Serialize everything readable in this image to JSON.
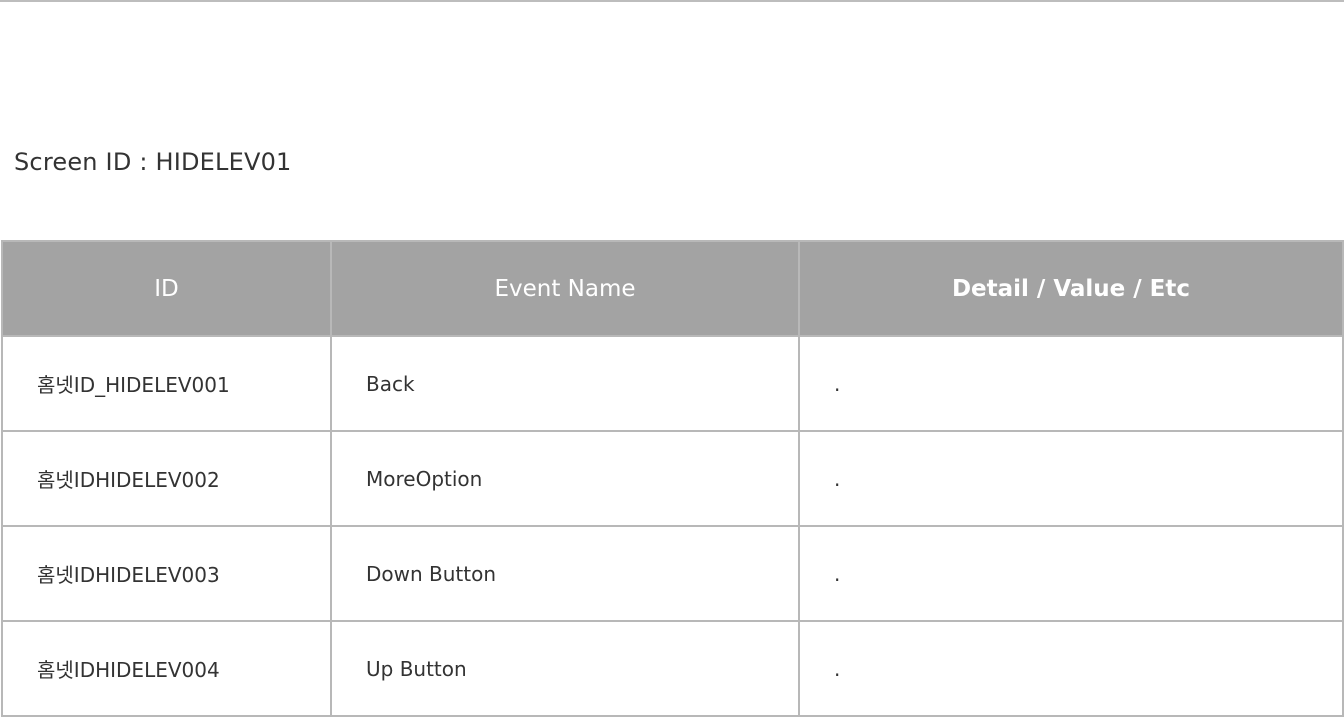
{
  "screen_id": "Screen ID : HIDELEV01",
  "table": {
    "headers": {
      "id": "ID",
      "event_name": "Event Name",
      "detail": "Detail / Value / Etc"
    },
    "rows": [
      {
        "id": "홈넷ID_HIDELEV001",
        "event_name": "Back",
        "detail": "."
      },
      {
        "id": "홈넷IDHIDELEV002",
        "event_name": "MoreOption",
        "detail": "."
      },
      {
        "id": "홈넷IDHIDELEV003",
        "event_name": "Down Button",
        "detail": "."
      },
      {
        "id": "홈넷IDHIDELEV004",
        "event_name": "Up Button",
        "detail": "."
      }
    ]
  }
}
